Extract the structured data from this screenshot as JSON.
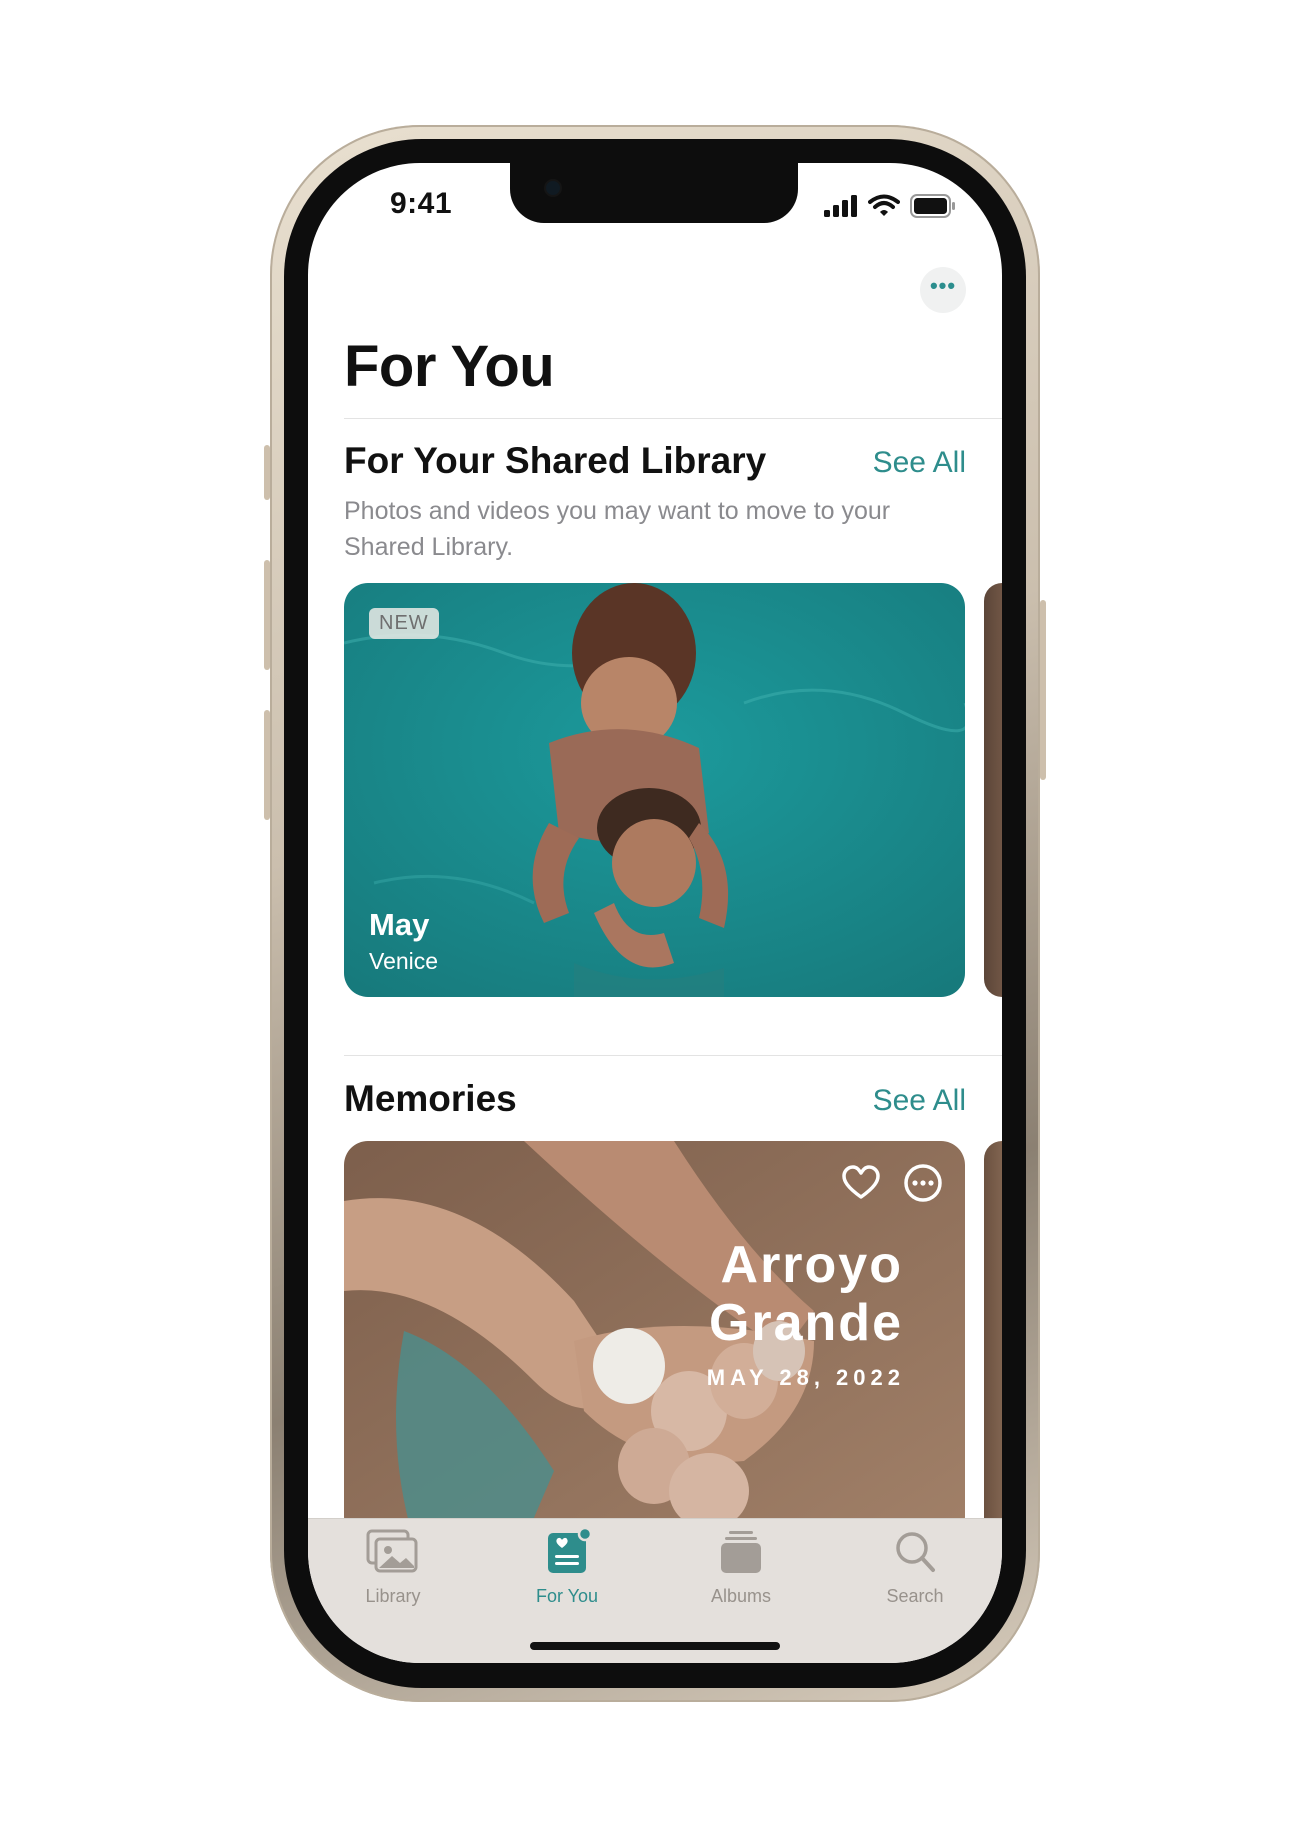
{
  "status_bar": {
    "time": "9:41"
  },
  "header": {
    "title": "For You",
    "more_icon": "ellipsis-icon"
  },
  "shared_library": {
    "title": "For Your Shared Library",
    "see_all": "See All",
    "description": "Photos and videos you may want to move to your Shared Library.",
    "card": {
      "badge": "NEW",
      "title": "May",
      "subtitle": "Venice"
    }
  },
  "memories": {
    "title": "Memories",
    "see_all": "See All",
    "card": {
      "title_line1": "Arroyo",
      "title_line2": "Grande",
      "date": "MAY 28, 2022"
    }
  },
  "tabbar": {
    "tabs": [
      {
        "label": "Library",
        "icon": "photo-library-icon"
      },
      {
        "label": "For You",
        "icon": "for-you-icon",
        "active": true
      },
      {
        "label": "Albums",
        "icon": "albums-icon"
      },
      {
        "label": "Search",
        "icon": "search-icon"
      }
    ]
  },
  "colors": {
    "accent": "#2e8d8c",
    "pool": "#1f8a8c",
    "sand": "#8f6f58"
  }
}
